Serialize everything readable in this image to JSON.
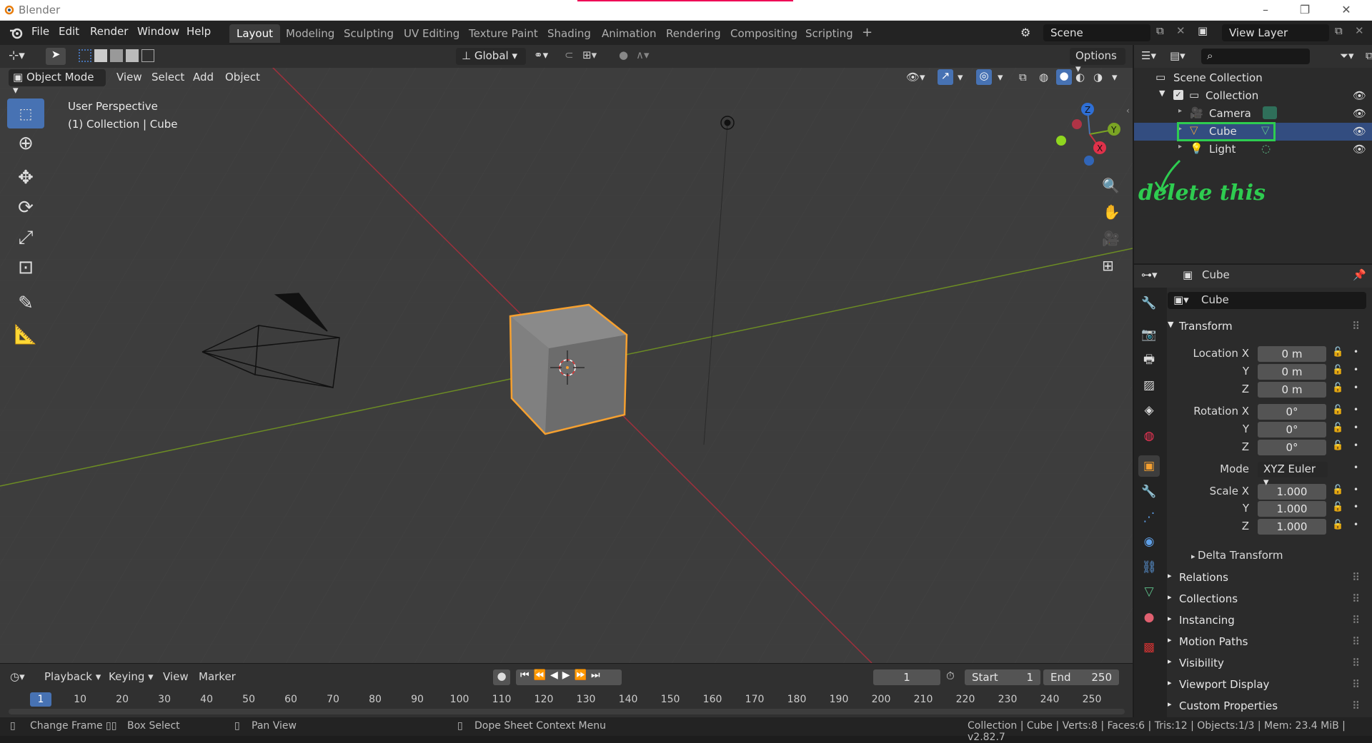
{
  "window": {
    "title": "Blender",
    "controls": [
      "–",
      "❐",
      "✕"
    ]
  },
  "menu": [
    "File",
    "Edit",
    "Render",
    "Window",
    "Help"
  ],
  "workspaces": [
    "Layout",
    "Modeling",
    "Sculpting",
    "UV Editing",
    "Texture Paint",
    "Shading",
    "Animation",
    "Rendering",
    "Compositing",
    "Scripting",
    "+"
  ],
  "scene": {
    "name": "Scene",
    "view_layer": "View Layer"
  },
  "viewport": {
    "transform_orientation": "Global",
    "options_label": "Options",
    "mode": "Object Mode",
    "menus": [
      "View",
      "Select",
      "Add",
      "Object"
    ],
    "overlay_line1": "User Perspective",
    "overlay_line2": "(1) Collection | Cube",
    "gizmo": {
      "z": "Z",
      "y": "Y",
      "x": "X"
    }
  },
  "outliner": {
    "search_placeholder": "",
    "scene_collection": "Scene Collection",
    "collection": "Collection",
    "items": [
      "Camera",
      "Cube",
      "Light"
    ],
    "annotation": "delete this"
  },
  "properties": {
    "header_object": "Cube",
    "object_name": "Cube",
    "transform": "Transform",
    "location_label": "Location X",
    "location": [
      "0 m",
      "0 m",
      "0 m"
    ],
    "rotation_label": "Rotation X",
    "rotation": [
      "0°",
      "0°",
      "0°"
    ],
    "axis_y": "Y",
    "axis_z": "Z",
    "mode_label": "Mode",
    "mode_value": "XYZ Euler",
    "scale_label": "Scale X",
    "scale": [
      "1.000",
      "1.000",
      "1.000"
    ],
    "delta": "Delta Transform",
    "panels": [
      "Relations",
      "Collections",
      "Instancing",
      "Motion Paths",
      "Visibility",
      "Viewport Display",
      "Custom Properties"
    ]
  },
  "timeline": {
    "menus": [
      "Playback",
      "Keying",
      "View",
      "Marker"
    ],
    "current_frame": "1",
    "start_label": "Start",
    "start": "1",
    "end_label": "End",
    "end": "250",
    "ticks": [
      "1",
      "10",
      "20",
      "30",
      "40",
      "50",
      "60",
      "70",
      "80",
      "90",
      "100",
      "110",
      "120",
      "130",
      "140",
      "150",
      "160",
      "170",
      "180",
      "190",
      "200",
      "210",
      "220",
      "230",
      "240",
      "250"
    ]
  },
  "status": {
    "hints": [
      "Change Frame",
      "Box Select",
      "Pan View",
      "Dope Sheet Context Menu"
    ],
    "info": "Collection | Cube | Verts:8 | Faces:6 | Tris:12 | Objects:1/3 | Mem: 23.4 MiB | v2.82.7"
  },
  "colors": {
    "accent": "#4772b3",
    "selected_outline": "#f5a030",
    "annotation": "#2ecc50",
    "x_axis": "#c8303f",
    "y_axis": "#7aa424"
  }
}
